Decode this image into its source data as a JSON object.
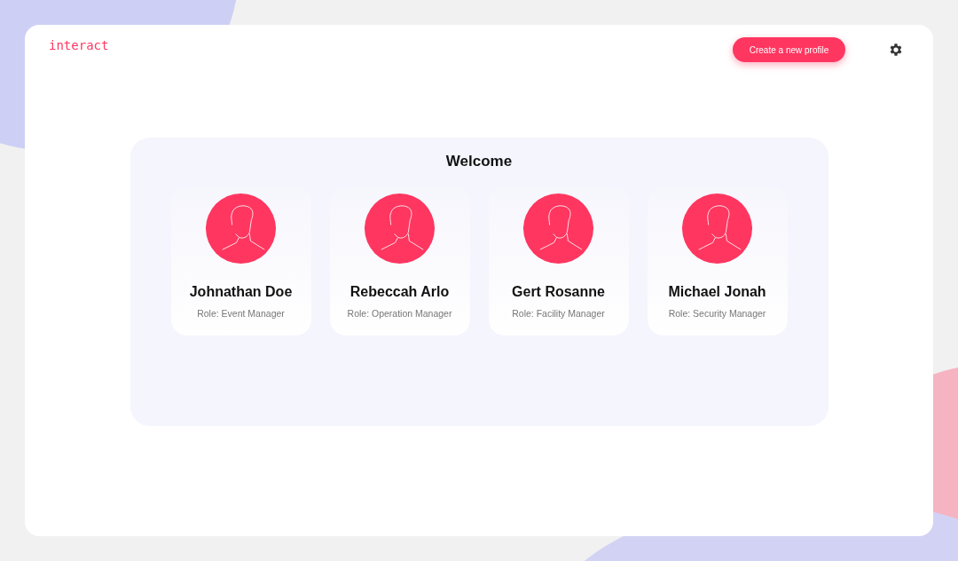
{
  "header": {
    "logo": "interact",
    "create_button": "Create a new profile"
  },
  "welcome": {
    "title": "Welcome",
    "profiles": [
      {
        "name": "Johnathan Doe",
        "role": "Role: Event Manager"
      },
      {
        "name": "Rebeccah Arlo",
        "role": "Role: Operation Manager"
      },
      {
        "name": "Gert Rosanne",
        "role": "Role: Facility Manager"
      },
      {
        "name": "Michael Jonah",
        "role": "Role: Security Manager"
      }
    ]
  }
}
